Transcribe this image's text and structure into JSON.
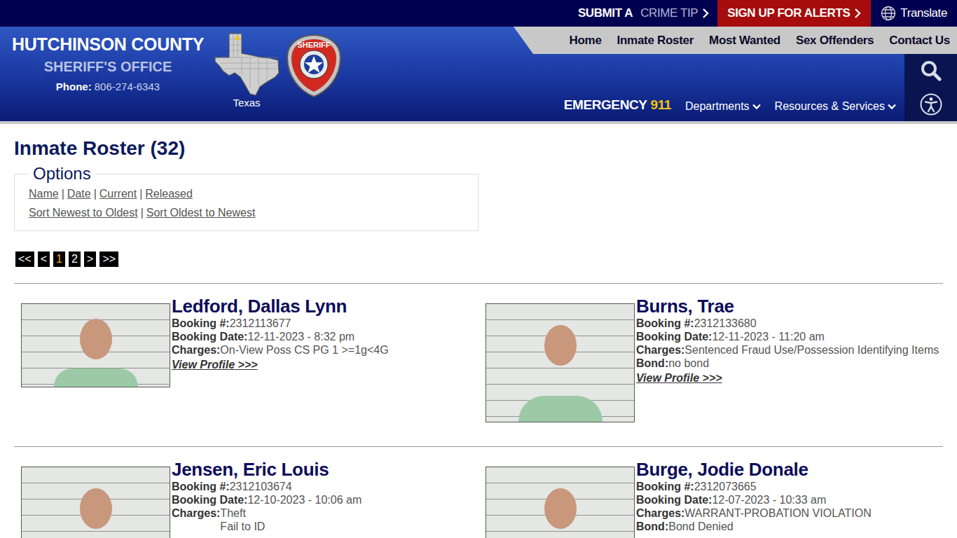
{
  "topbar": {
    "crime_tip": {
      "lead": "SUBMIT A",
      "rest": "CRIME TIP"
    },
    "alerts": "SIGN UP FOR ALERTS",
    "translate": "Translate"
  },
  "logo": {
    "county": "HUTCHINSON COUNTY",
    "office": "SHERIFF'S OFFICE",
    "phone_label": "Phone:",
    "phone": "806-274-6343",
    "map_label": "Texas",
    "badge_label": "SHERIFF"
  },
  "nav": [
    "Home",
    "Inmate Roster",
    "Most Wanted",
    "Sex Offenders",
    "Contact Us"
  ],
  "emergency": {
    "label": "EMERGENCY",
    "number": "911"
  },
  "menus": [
    "Departments",
    "Resources & Services"
  ],
  "page": {
    "title": "Inmate Roster (32)"
  },
  "options": {
    "legend": "Options",
    "separator": "|",
    "rows": [
      [
        "Name",
        "Date",
        "Current",
        "Released"
      ],
      [
        "Sort Newest to Oldest",
        "Sort Oldest to Newest"
      ]
    ]
  },
  "pagination": [
    {
      "label": "<<",
      "selected": false
    },
    {
      "label": "<",
      "selected": false
    },
    {
      "label": "1",
      "selected": true
    },
    {
      "label": "2",
      "selected": false
    },
    {
      "label": ">",
      "selected": false
    },
    {
      "label": ">>",
      "selected": false
    }
  ],
  "inmates": [
    {
      "name": "Ledford, Dallas Lynn",
      "fields": [
        {
          "label": "Booking #:",
          "values": [
            "2312113677"
          ]
        },
        {
          "label": "Booking Date:",
          "values": [
            "12-11-2023 - 8:32 pm"
          ]
        },
        {
          "label": "Charges:",
          "values": [
            "On-View Poss CS PG 1 >=1g<4G"
          ]
        }
      ],
      "link": "View Profile >>>"
    },
    {
      "name": "Burns, Trae",
      "fields": [
        {
          "label": "Booking #:",
          "values": [
            "2312133680"
          ]
        },
        {
          "label": "Booking Date:",
          "values": [
            "12-11-2023 - 11:20 am"
          ]
        },
        {
          "label": "Charges:",
          "values": [
            "Sentenced Fraud Use/Possession Identifying Items"
          ]
        },
        {
          "label": "Bond:",
          "values": [
            "no bond"
          ]
        }
      ],
      "link": "View Profile >>>"
    },
    {
      "name": "Jensen, Eric Louis",
      "fields": [
        {
          "label": "Booking #:",
          "values": [
            "2312103674"
          ]
        },
        {
          "label": "Booking Date:",
          "values": [
            "12-10-2023 - 10:06 am"
          ]
        },
        {
          "label": "Charges:",
          "values": [
            "Theft",
            "Fail to ID"
          ]
        }
      ],
      "link": ""
    },
    {
      "name": "Burge, Jodie Donale",
      "fields": [
        {
          "label": "Booking #:",
          "values": [
            "2312073665"
          ]
        },
        {
          "label": "Booking Date:",
          "values": [
            "12-07-2023 - 10:33 am"
          ]
        },
        {
          "label": "Charges:",
          "values": [
            "WARRANT-PROBATION VIOLATION"
          ]
        },
        {
          "label": "Bond:",
          "values": [
            "Bond Denied"
          ]
        }
      ],
      "link": ""
    }
  ]
}
